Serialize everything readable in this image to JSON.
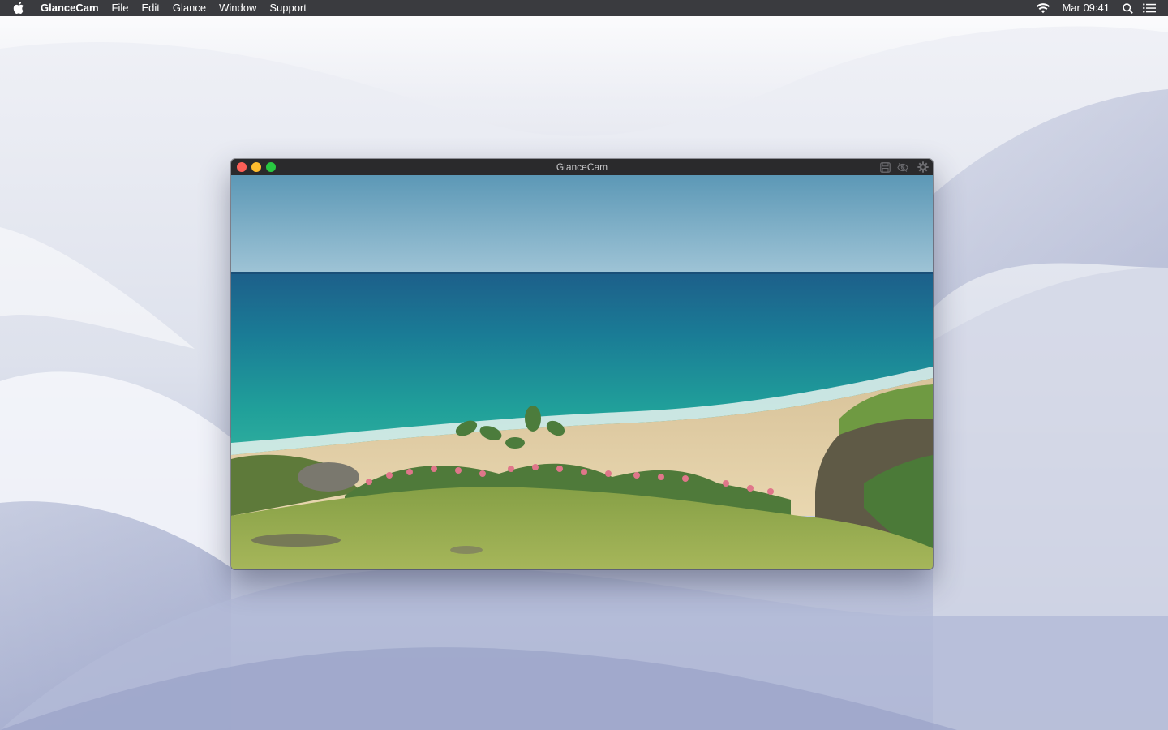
{
  "menubar": {
    "apple_icon": "apple-icon",
    "app_name": "GlanceCam",
    "menus": [
      "File",
      "Edit",
      "Glance",
      "Window",
      "Support"
    ],
    "clock": "Mar 09:41",
    "status_icons": [
      "wifi-icon",
      "spotlight-search-icon",
      "notification-center-icon"
    ]
  },
  "window": {
    "title": "GlanceCam",
    "toolbar_icons": [
      "save-icon",
      "hide-icon",
      "settings-gear-icon"
    ],
    "traffic_light_colors": {
      "close": "#fd5f57",
      "minimize": "#febc2e",
      "zoom": "#28c841"
    }
  },
  "theme": {
    "menubar_bg": "#3a3b3f",
    "titlebar_bg": "#2a2a2c"
  }
}
